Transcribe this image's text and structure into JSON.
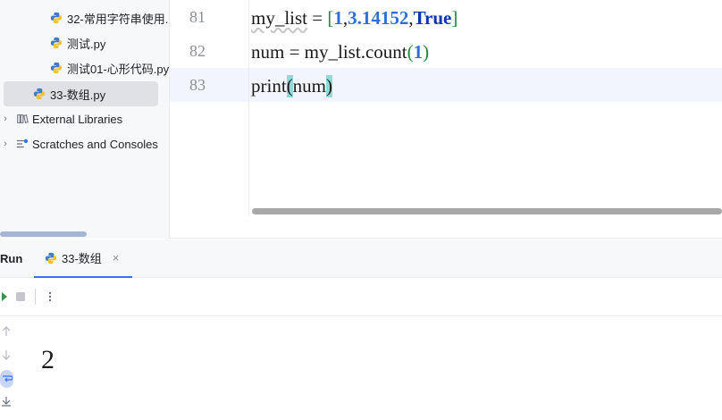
{
  "sidebar": {
    "items": [
      {
        "label": "32-常用字符串使用."
      },
      {
        "label": "测试.py"
      },
      {
        "label": "测试01-心形代码.py"
      },
      {
        "label": "33-数组.py"
      },
      {
        "label": "External Libraries"
      },
      {
        "label": "Scratches and Consoles"
      }
    ]
  },
  "editor": {
    "lines": [
      {
        "num": "81",
        "code": "my_list = [1,3.14152,True]"
      },
      {
        "num": "82",
        "code": "num = my_list.count(1)"
      },
      {
        "num": "83",
        "code": "print(num)"
      }
    ],
    "tokens": {
      "l81_var": "my_list",
      "l81_eq": " = ",
      "l81_open": "[",
      "l81_n1": "1",
      "l81_c1": ",",
      "l81_n2": "3.14152",
      "l81_c2": ",",
      "l81_kw": "True",
      "l81_close": "]",
      "l82_a": "num = my_list.count",
      "l82_open": "(",
      "l82_n": "1",
      "l82_close": ")",
      "l83_fn": "print",
      "l83_open": "(",
      "l83_arg": "num",
      "l83_close": ")"
    }
  },
  "run": {
    "title": "Run",
    "tab_label": "33-数组",
    "tab_close": "×",
    "output": "2"
  },
  "colors": {
    "accent": "#3574f0",
    "keyword": "#0033b3",
    "number": "#1750eb",
    "bracket": "#1e8a3a",
    "paren_highlight": "#93d9d9"
  },
  "icons": [
    "python-file-icon",
    "chevron-right-icon",
    "library-icon",
    "scratches-icon",
    "rerun-icon",
    "stop-icon",
    "more-icon",
    "arrow-up-icon",
    "arrow-down-icon",
    "soft-wrap-icon",
    "scroll-to-end-icon",
    "close-icon"
  ]
}
